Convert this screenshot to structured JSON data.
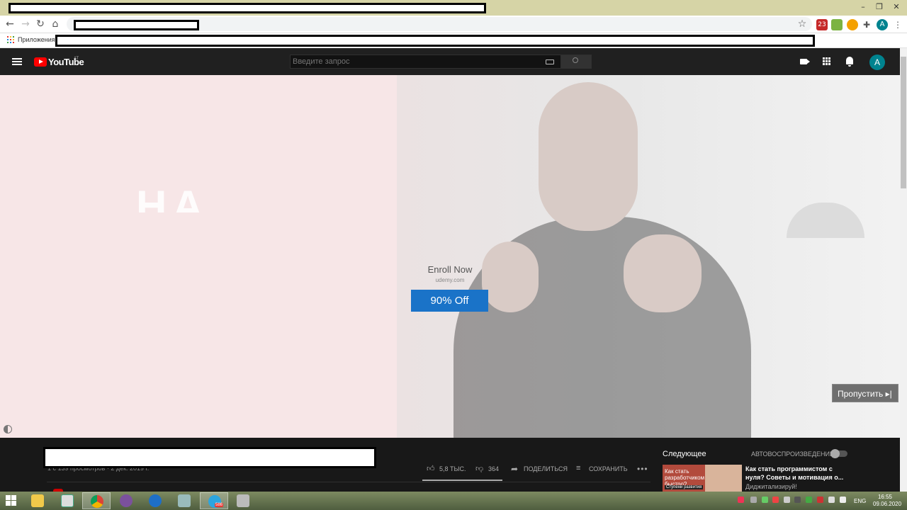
{
  "browser": {
    "bookmarks_apps_label": "Приложения",
    "extension_badge": "23"
  },
  "youtube": {
    "logo_text": "YouTube",
    "region": "AT",
    "search_placeholder": "Введите запрос",
    "avatar_letter": "A"
  },
  "ad": {
    "overlay_text": "НА",
    "title": "Enroll Now",
    "domain": "udemy.com",
    "cta_label": "90% Off",
    "skip_label": "Пропустить ▸|"
  },
  "video_info": {
    "views_date": "1 с 139 просмотров · 2 дек. 2019 г.",
    "likes": "5,8 ТЫС.",
    "dislikes": "364",
    "share_label": "ПОДЕЛИТЬСЯ",
    "save_label": "СОХРАНИТЬ"
  },
  "sidebar": {
    "up_next_label": "Следующее",
    "autoplay_label": "АВТОВОСПРОИЗВЕДЕНИЕ",
    "recommended": {
      "thumb_text": "Как стать разработчиком быстро?",
      "thumb_sub": "Ступени развития",
      "title": "Как стать программистом с нуля? Советы и мотивация о...",
      "channel": "Диджитализируй!"
    }
  },
  "taskbar": {
    "lang": "ENG",
    "time": "16:55",
    "date": "09.06.2020",
    "telegram_badge": "586"
  },
  "colors": {
    "youtube_red": "#ff0000",
    "cta_blue": "#1a73c8",
    "avatar_teal": "#00838f"
  }
}
